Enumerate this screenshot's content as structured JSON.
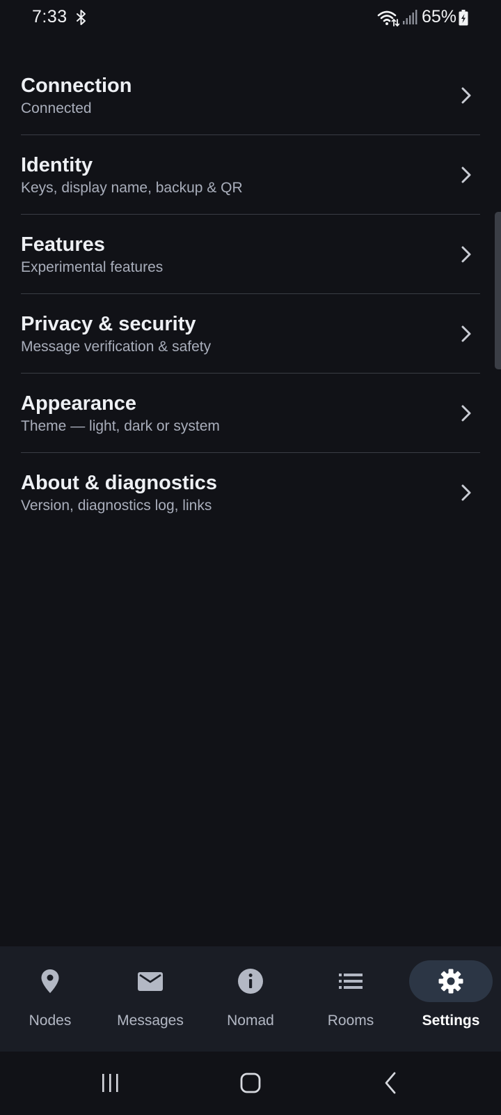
{
  "status_bar": {
    "time": "7:33",
    "battery": "65%",
    "icons": [
      "bluetooth-icon",
      "wifi-icon",
      "signal-icon",
      "battery-charging-icon"
    ]
  },
  "settings": {
    "items": [
      {
        "title": "Connection",
        "subtitle": "Connected"
      },
      {
        "title": "Identity",
        "subtitle": "Keys, display name, backup & QR"
      },
      {
        "title": "Features",
        "subtitle": "Experimental features"
      },
      {
        "title": "Privacy & security",
        "subtitle": "Message verification & safety"
      },
      {
        "title": "Appearance",
        "subtitle": "Theme — light, dark or system"
      },
      {
        "title": "About & diagnostics",
        "subtitle": "Version, diagnostics log, links"
      }
    ]
  },
  "bottom_nav": {
    "items": [
      {
        "label": "Nodes",
        "icon": "location-pin-icon"
      },
      {
        "label": "Messages",
        "icon": "mail-icon"
      },
      {
        "label": "Nomad",
        "icon": "info-icon"
      },
      {
        "label": "Rooms",
        "icon": "list-icon"
      },
      {
        "label": "Settings",
        "icon": "gear-icon"
      }
    ],
    "active": "Settings"
  },
  "system_nav": {
    "buttons": [
      "recents-icon",
      "home-icon",
      "back-icon"
    ]
  },
  "colors": {
    "background": "#111217",
    "nav_background": "#1a1d25",
    "active_pill": "#2c3645",
    "divider": "#3a3d45",
    "title_text": "#eef0f4",
    "subtitle_text": "#a9aebb"
  }
}
